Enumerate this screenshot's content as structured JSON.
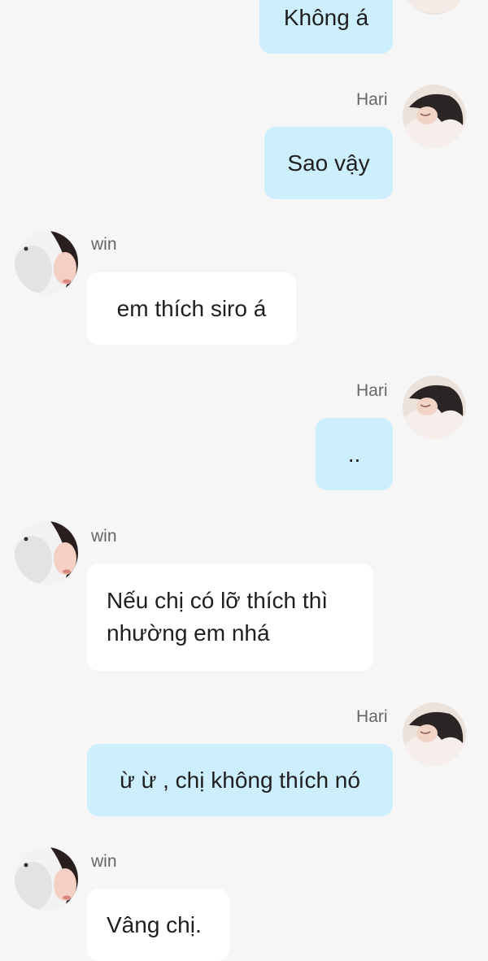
{
  "messages": [
    {
      "id": 0,
      "sender": "Hari",
      "side": "right",
      "text": "Không á",
      "show_name": false
    },
    {
      "id": 1,
      "sender": "Hari",
      "side": "right",
      "text": "Sao vậy",
      "show_name": true
    },
    {
      "id": 2,
      "sender": "win",
      "side": "left",
      "text": "em thích siro á",
      "show_name": true
    },
    {
      "id": 3,
      "sender": "Hari",
      "side": "right",
      "text": "..",
      "show_name": true
    },
    {
      "id": 4,
      "sender": "win",
      "side": "left",
      "lines": [
        "Nếu chị có lỡ thích thì",
        "nhường em nhá"
      ],
      "show_name": true
    },
    {
      "id": 5,
      "sender": "Hari",
      "side": "right",
      "text": "ừ ừ , chị không thích nó",
      "show_name": true
    },
    {
      "id": 6,
      "sender": "win",
      "side": "left",
      "text": "Vâng chị.",
      "show_name": true
    }
  ],
  "colors": {
    "background": "#f6f6f7",
    "bubble_mine": "#cdeefd",
    "bubble_theirs": "#ffffff",
    "name_text": "#666666"
  },
  "avatars": {
    "Hari": "avatar-hari",
    "win": "avatar-win"
  }
}
